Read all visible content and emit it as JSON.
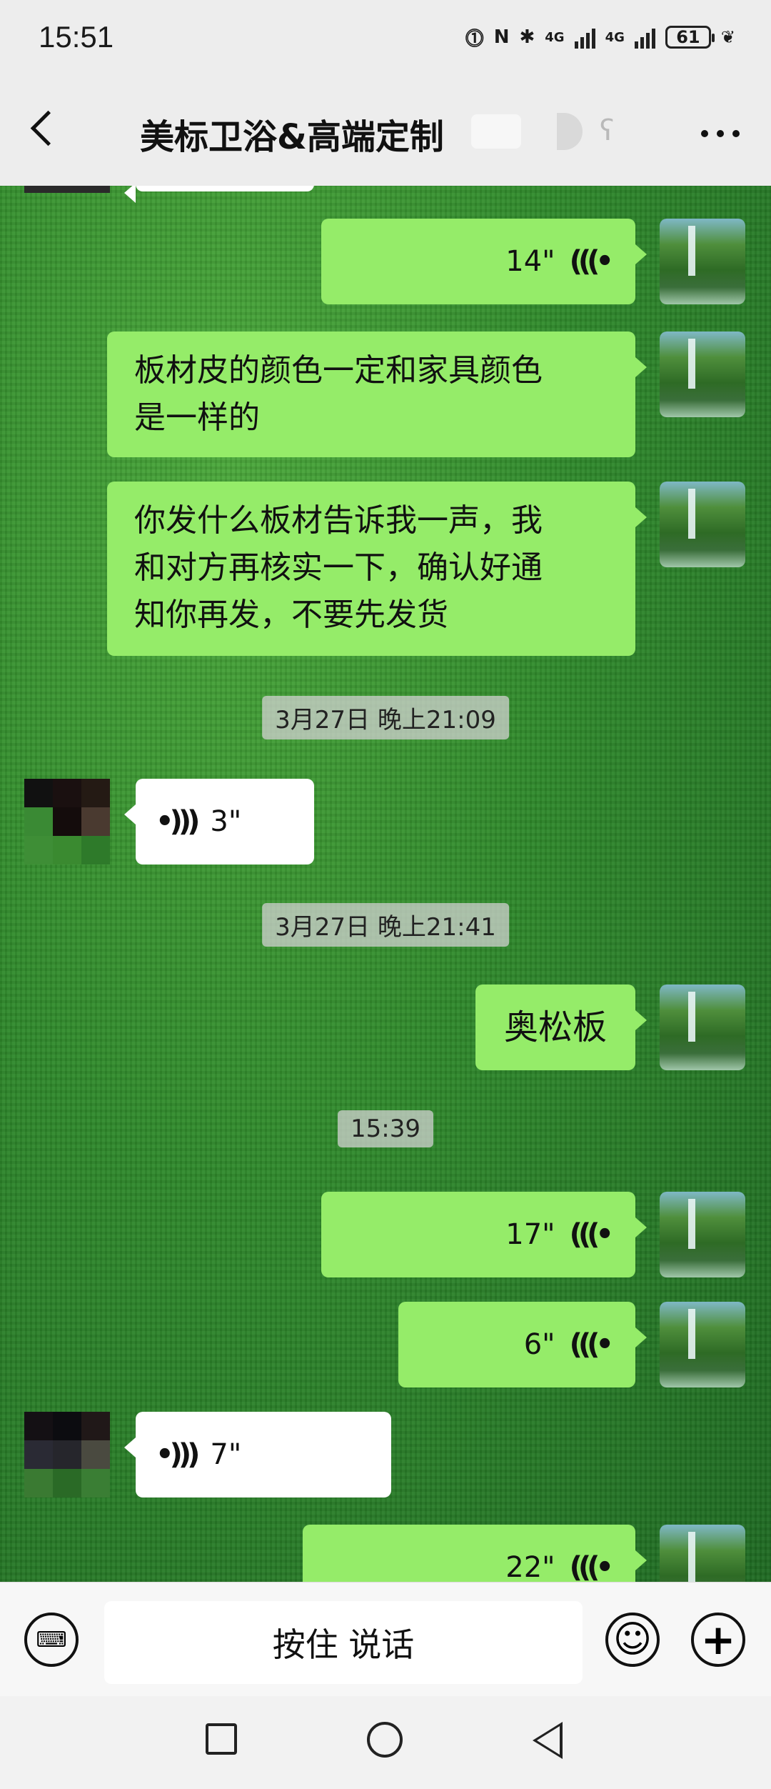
{
  "status": {
    "time": "15:51",
    "battery": "61",
    "network1": "4G",
    "network2": "4G"
  },
  "header": {
    "title": "美标卫浴&高端定制",
    "back_icon": "chevron-left-icon",
    "more_icon": "more-dots-icon"
  },
  "messages": {
    "m1": {
      "sender": "me",
      "type": "voice",
      "duration": "14\""
    },
    "m2": {
      "sender": "me",
      "type": "text",
      "lines": [
        "板材皮的颜色一定和家具颜色",
        "是一样的"
      ]
    },
    "m3": {
      "sender": "me",
      "type": "text",
      "lines": [
        "你发什么板材告诉我一声，我",
        "和对方再核实一下，确认好通",
        "知你再发，不要先发货"
      ]
    },
    "ts1": "3月27日 晚上21:09",
    "m4": {
      "sender": "other",
      "type": "voice",
      "duration": "3\""
    },
    "ts2": "3月27日 晚上21:41",
    "m5": {
      "sender": "me",
      "type": "text",
      "text": "奥松板"
    },
    "ts3": "15:39",
    "m6": {
      "sender": "me",
      "type": "voice",
      "duration": "17\""
    },
    "m7": {
      "sender": "me",
      "type": "voice",
      "duration": "6\""
    },
    "m8": {
      "sender": "other",
      "type": "voice",
      "duration": "7\""
    },
    "m9": {
      "sender": "me",
      "type": "voice",
      "duration": "22\""
    }
  },
  "input": {
    "hold_to_talk": "按住 说话"
  },
  "colors": {
    "my_bubble": "#95ec69",
    "their_bubble": "#ffffff"
  }
}
